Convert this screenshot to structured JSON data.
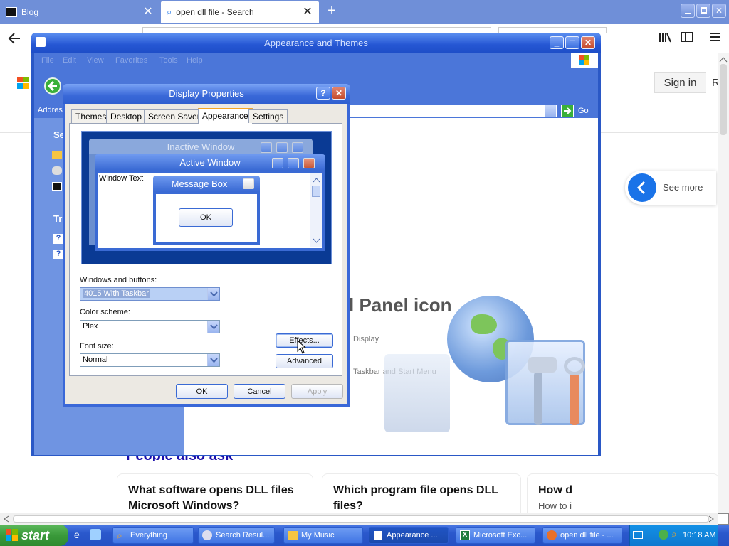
{
  "browser": {
    "tabs": [
      {
        "label": "Blog"
      },
      {
        "label": "open dll file - Search"
      }
    ],
    "sign_in": "Sign in",
    "sign_in_cut": "R"
  },
  "page": {
    "see_more": "See more",
    "people_also_ask": "People also ask",
    "cards": [
      {
        "text": "What software opens DLL files Microsoft Windows?"
      },
      {
        "text": "Which program file opens DLL files?"
      },
      {
        "text": "How d",
        "sub": "How to i"
      }
    ]
  },
  "appearance_window": {
    "title": "Appearance and Themes",
    "menu": [
      "File",
      "Edit",
      "View",
      "Favorites",
      "Tools",
      "Help"
    ],
    "address_label": "Address",
    "go": "Go",
    "left_fragments": [
      "Se",
      "Tr"
    ],
    "panel_title": "l Panel icon",
    "tasks": [
      "Display",
      "Taskbar and Start Menu"
    ]
  },
  "display_properties": {
    "title": "Display Properties",
    "tabs": [
      "Themes",
      "Desktop",
      "Screen Saver",
      "Appearance",
      "Settings"
    ],
    "selected_tab": "Appearance",
    "preview": {
      "inactive": "Inactive Window",
      "active": "Active Window",
      "window_text": "Window Text",
      "message_box": "Message Box",
      "ok": "OK"
    },
    "windows_buttons_label": "Windows and buttons:",
    "windows_buttons_value": "4015 With Taskbar",
    "color_scheme_label": "Color scheme:",
    "color_scheme_value": "Plex",
    "font_size_label": "Font size:",
    "font_size_value": "Normal",
    "effects": "Effects...",
    "advanced": "Advanced",
    "ok": "OK",
    "cancel": "Cancel",
    "apply": "Apply"
  },
  "taskbar": {
    "start": "start",
    "items": [
      {
        "label": "Everything"
      },
      {
        "label": "Search Resul..."
      },
      {
        "label": "My Music"
      },
      {
        "label": "Appearance ..."
      },
      {
        "label": "Microsoft Exc..."
      },
      {
        "label": "open dll file - ..."
      }
    ],
    "clock": "10:18 AM"
  },
  "colors": {
    "xp_blue": "#2a58c6",
    "start_green": "#3a9a3a",
    "link_blue": "#1a73e8"
  }
}
